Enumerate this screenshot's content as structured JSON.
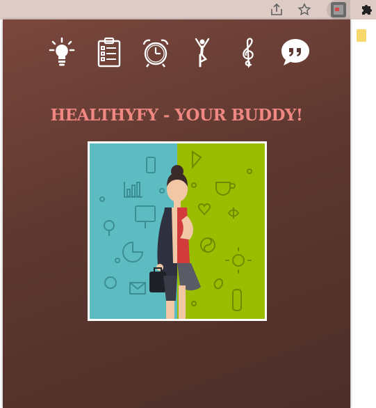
{
  "browser": {
    "toolbar_icons": [
      "share-icon",
      "star-icon",
      "extension-icon",
      "puzzle-icon"
    ],
    "background": "#decbc6"
  },
  "popup": {
    "title": "HEALTHYFY - YOUR BUDDY!",
    "title_color": "#f08783",
    "nav_icons": [
      {
        "name": "lightbulb-icon"
      },
      {
        "name": "clipboard-icon"
      },
      {
        "name": "alarm-clock-icon"
      },
      {
        "name": "yoga-icon"
      },
      {
        "name": "music-icon"
      },
      {
        "name": "quote-icon"
      }
    ],
    "hero_image": {
      "left_color": "#5cbcc1",
      "right_color": "#9bbd00"
    }
  }
}
